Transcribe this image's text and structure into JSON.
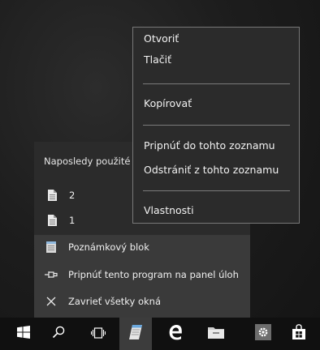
{
  "jumplist": {
    "recent_header": "Naposledy použité",
    "recent_items": [
      {
        "label": "2",
        "icon": "document-icon"
      },
      {
        "label": "1",
        "icon": "document-icon"
      }
    ],
    "tasks": [
      {
        "label": "Poznámkový blok",
        "icon": "notepad-icon"
      },
      {
        "label": "Pripnúť tento program na panel úloh",
        "icon": "pin-icon"
      },
      {
        "label": "Zavrieť všetky okná",
        "icon": "close-icon"
      }
    ]
  },
  "context_menu": {
    "items": [
      "Otvoriť",
      "Tlačiť",
      "Kopírovať",
      "Pripnúť do tohto zoznamu",
      "Odstrániť z tohto zoznamu",
      "Vlastnosti"
    ]
  },
  "taskbar": {
    "buttons": [
      "windows-start-icon",
      "search-icon",
      "task-view-icon",
      "notepad-icon",
      "edge-icon",
      "file-explorer-icon",
      "settings-icon",
      "store-icon"
    ]
  },
  "colors": {
    "menu_bg": "#2b2b2b",
    "tasks_bg": "#3a3a3a",
    "taskbar_bg": "#101010",
    "separator": "#7a7a7a"
  }
}
